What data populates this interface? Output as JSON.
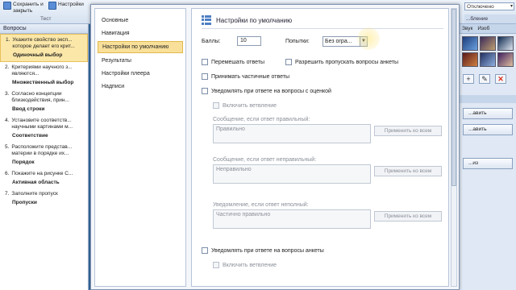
{
  "ribbon": {
    "save_close_label": "Сохранить и закрыть",
    "settings_label": "Настройки",
    "group_label": "Тест",
    "status_value": "Отключено",
    "right_label": "...бление"
  },
  "left_pane": {
    "header": "Вопросы",
    "questions": [
      {
        "num": "1.",
        "text": "Укажите свойство эксп... которое делает его крит...",
        "type": "Одиночный выбор"
      },
      {
        "num": "2.",
        "text": "Критериями научного з... являются...",
        "type": "Множественный выбор"
      },
      {
        "num": "3.",
        "text": "Согласно концепции близкодействия, прин...",
        "type": "Ввод строки"
      },
      {
        "num": "4.",
        "text": "Установите соответств... научными картинами м...",
        "type": "Соответствие"
      },
      {
        "num": "5.",
        "text": "Расположите представ... материи в порядке их...",
        "type": "Порядок"
      },
      {
        "num": "6.",
        "text": "Покажите на рисунке С...",
        "type": "Активная область"
      },
      {
        "num": "7.",
        "text": "Заполните пропуск",
        "type": "Пропуски"
      }
    ]
  },
  "right_pane": {
    "tabs": [
      "Звук",
      "Изоб"
    ],
    "buttons": [
      "...авить",
      "...авить",
      "...из"
    ]
  },
  "dialog": {
    "nav": [
      "Основные",
      "Навигация",
      "Настройки по умолчанию",
      "Результаты",
      "Настройки плеера",
      "Надписи"
    ],
    "title": "Настройки по умолчанию",
    "points_label": "Баллы:",
    "points_value": "10",
    "attempts_label": "Попытки:",
    "attempts_value": "Без огра...",
    "shuffle_label": "Перемешать ответы",
    "allow_skip_label": "Разрешить пропускать вопросы анкеты",
    "partial_label": "Принимать частичные ответы",
    "notify_graded_label": "Уведомлять при ответе на вопросы с оценкой",
    "enable_branching_label": "Включить ветвление",
    "correct_msg_label": "Сообщение, если ответ правильный:",
    "correct_msg_value": "Правильно",
    "incorrect_msg_label": "Сообщение, если ответ неправильный:",
    "incorrect_msg_value": "Неправильно",
    "partial_msg_label": "Уведомление, если ответ неполный:",
    "partial_msg_value": "Частично правильно",
    "apply_all_label": "Применить ко всем",
    "notify_survey_label": "Уведомлять при ответе на вопросы анкеты",
    "enable_branching2_label": "Включить ветвление"
  }
}
